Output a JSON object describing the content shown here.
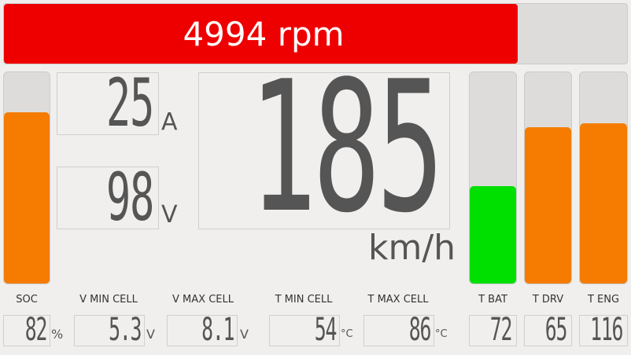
{
  "colors": {
    "rpm": "#ef0000",
    "bar_orange": "#f57c00",
    "bar_green": "#00e000"
  },
  "rpm": {
    "text": "4994 rpm",
    "value": 4994,
    "fraction": 0.825
  },
  "current": {
    "value": "25",
    "unit": "A"
  },
  "voltage": {
    "value": "98",
    "unit": "V"
  },
  "speed": {
    "value": "185",
    "unit": "km/h"
  },
  "soc_bar": {
    "fraction": 0.81
  },
  "temp_bars": {
    "t_bat": {
      "fraction": 0.46,
      "color": "#00e000"
    },
    "t_drv": {
      "fraction": 0.74,
      "color": "#f57c00"
    },
    "t_eng": {
      "fraction": 0.76,
      "color": "#f57c00"
    }
  },
  "readouts": {
    "soc": {
      "label": "SOC",
      "value": "82",
      "unit": "%"
    },
    "v_min_cell": {
      "label": "V MIN CELL",
      "value": "5.3",
      "unit": "V"
    },
    "v_max_cell": {
      "label": "V MAX CELL",
      "value": "8.1",
      "unit": "V"
    },
    "t_min_cell": {
      "label": "T MIN CELL",
      "value": "54",
      "unit": "°C"
    },
    "t_max_cell": {
      "label": "T MAX CELL",
      "value": "86",
      "unit": "°C"
    },
    "t_bat": {
      "label": "T BAT",
      "value": "72",
      "unit": ""
    },
    "t_drv": {
      "label": "T DRV",
      "value": "65",
      "unit": ""
    },
    "t_eng": {
      "label": "T ENG",
      "value": "116",
      "unit": ""
    }
  }
}
